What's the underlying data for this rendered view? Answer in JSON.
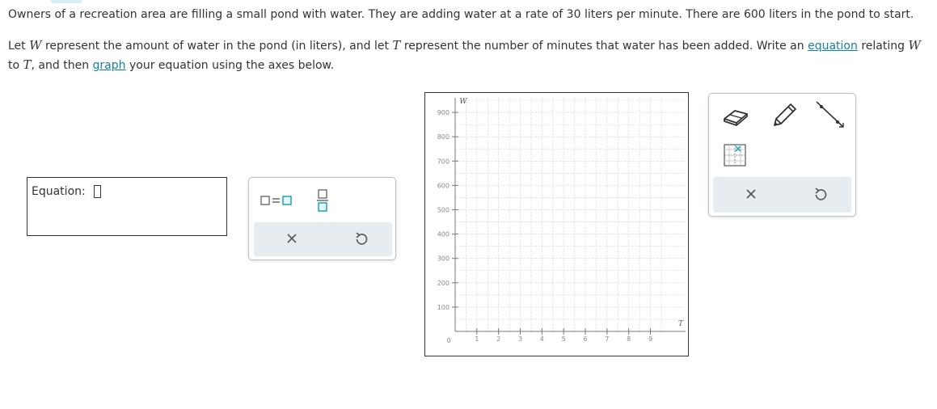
{
  "problem": {
    "p1": "Owners of a recreation area are filling a small pond with water. They are adding water at a rate of 30 liters per minute. There are 600 liters in the pond to start.",
    "p2_before_w": "Let ",
    "var_w": "W",
    "p2_after_w": " represent the amount of water in the pond (in liters), and let ",
    "var_t": "T",
    "p2_after_t": " represent the number of minutes that water has been added. Write an ",
    "link_equation": "equation",
    "p2_relating": " relating ",
    "p3_to": "to ",
    "p3_comma": ", and then ",
    "link_graph": "graph",
    "p3_end": " your equation using the axes below."
  },
  "equation_input": {
    "label": "Equation:",
    "value": ""
  },
  "keypad": {
    "buttons": [
      "equals-template-icon",
      "fraction-template-icon"
    ],
    "clear_icon": "x-icon",
    "undo_icon": "undo-icon"
  },
  "graph": {
    "x_axis_label": "T",
    "y_axis_label": "W",
    "origin_label": "0",
    "x_ticks": [
      "1",
      "2",
      "3",
      "4",
      "5",
      "6",
      "7",
      "8",
      "9"
    ],
    "y_ticks": [
      "100",
      "200",
      "300",
      "400",
      "500",
      "600",
      "700",
      "800",
      "900"
    ],
    "x_range": [
      0,
      9.8
    ],
    "y_range": [
      0,
      960
    ],
    "grid": true,
    "grid_color": "#bbbbbb"
  },
  "graph_tools": {
    "tools": [
      "eraser-icon",
      "pencil-icon",
      "line-icon",
      "point-grid-icon"
    ],
    "clear_icon": "x-icon",
    "undo_icon": "undo-icon"
  },
  "colors": {
    "link": "#16819f",
    "accent": "#1ba1b5",
    "tool_bar_bg": "#e6ecef"
  }
}
